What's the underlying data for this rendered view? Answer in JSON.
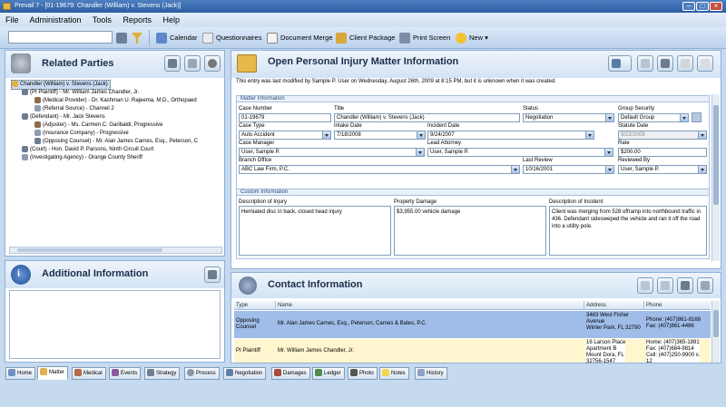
{
  "window": {
    "title": "Prevail 7 - [01-19679: Chandler (William) v. Stevens (Jack)]"
  },
  "menu": [
    "File",
    "Administration",
    "Tools",
    "Reports",
    "Help"
  ],
  "toolbar": {
    "search_value": "",
    "items": [
      "Calendar",
      "Questionnaires",
      "Document Merge",
      "Client Package",
      "Print Screen",
      "New"
    ]
  },
  "related": {
    "title": "Related Parties",
    "tree": [
      "Chandler (William) v. Stevens (Jack)",
      "(PI Plaintiff) - Mr. William James Chandler, Jr.",
      "(Medical Provider) - Dr. Kashman U. Rajeema, M.D., Orthopaed",
      "(Referral Source) - Channel 2",
      "(Defendant) - Mr. Jack Stevens",
      "(Adjuster) - Ms. Carmen C. Garibaldi, Progressive",
      "(Insurance Company) - Progressive",
      "(Opposing Counsel) - Mr. Alan James Carnes, Esq., Peterson, C",
      "(Court) - Hon. David P. Parsons, Ninth Circuit Court",
      "(Investigating Agency) - Orange County Sheriff"
    ]
  },
  "additional": {
    "title": "Additional Information"
  },
  "matter": {
    "title": "Open Personal Injury Matter Information",
    "note": "This entry was last modified by Sample P. User on Wednesday, August 26th, 2009 at 8:15 PM, but it is unknown when it was created.",
    "section": "Matter Information",
    "labels": {
      "case_number": "Case Number",
      "title": "Title",
      "status": "Status",
      "group_security": "Group Security",
      "case_type": "Case Type",
      "intake_date": "Intake Date",
      "incident_date": "Incident Date",
      "statute_date": "Statute Date",
      "case_manager": "Case Manager",
      "lead_attorney": "Lead Attorney",
      "rate": "Rate",
      "branch_office": "Branch Office",
      "last_review": "Last Review",
      "reviewed_by": "Reviewed By"
    },
    "values": {
      "case_number": "01-19679",
      "title": "Chandler (William) v. Stevens (Jack)",
      "status": "Negotiation",
      "group_security": "Default Group",
      "case_type": "Auto Accident",
      "intake_date": "7/18/2008",
      "incident_date": "9/24/2007",
      "statute_date": "9/22/2009",
      "case_manager": "User, Sample P.",
      "lead_attorney": "User, Sample P.",
      "rate": "$200.00",
      "branch_office": "ABC Law Firm, P.C.",
      "last_review": "10/16/2001",
      "reviewed_by": "User, Sample P."
    },
    "custom_section": "Custom Information",
    "custom_labels": {
      "injury": "Description of Injury",
      "property": "Property Damage",
      "incident": "Description of Incident"
    },
    "custom_values": {
      "injury": "Herniated disc in back, closed head injury",
      "property": "$3,955.00 vehicle damage",
      "incident": "Client was merging from 528 offramp into northbound traffic in 436.  Defendant sidesweped the vehicle and ran it off the road into a utility pole."
    }
  },
  "contact": {
    "title": "Contact Information",
    "columns": [
      "Type",
      "Name",
      "Address",
      "Phone"
    ],
    "rows": [
      {
        "type": "Opposing Counsel",
        "name": "Mr. Alan James Carnes, Esq., Peterson, Carnes & Bates, P.C.",
        "address": [
          "3483 West Fisher",
          "Avenue",
          "Winter Park, FL 32790"
        ],
        "phone": [
          "Phone: (407)861-8168",
          "Fax: (407)861-4486"
        ]
      },
      {
        "type": "PI Plaintiff",
        "name": "Mr. William James Chandler, Jr.",
        "address": [
          "16 Larson Place",
          "Apartment B",
          "Mount Dora, FL",
          "32756-1547"
        ],
        "phone": [
          "Home: (407)365-1891",
          "Fax: (407)684-9814",
          "Cell: (407)250-9900 x.",
          "12"
        ]
      }
    ]
  },
  "tabs": [
    "Home",
    "Matter",
    "Medical",
    "Events",
    "Strategy",
    "Process",
    "Negotiation",
    "Damages",
    "Ledger",
    "Photo",
    "Notes",
    "History"
  ],
  "active_tab": "Matter",
  "colors": {
    "accent": "#2c5da3",
    "panel_header": "#d3e3f5",
    "selected_row": "#9fbde8",
    "highlight_row": "#fff6cf"
  }
}
